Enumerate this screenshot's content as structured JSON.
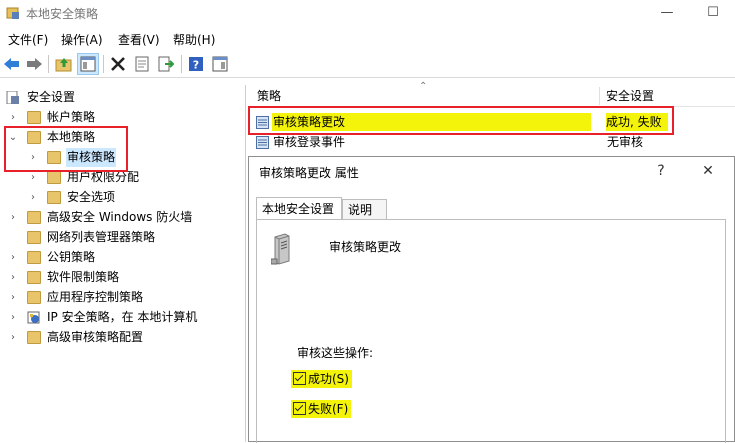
{
  "window": {
    "title": "本地安全策略",
    "minimize_glyph": "—",
    "maximize_glyph": "☐"
  },
  "menu": [
    "文件(F)",
    "操作(A)",
    "查看(V)",
    "帮助(H)"
  ],
  "toolbar": {
    "icons": [
      "back-icon",
      "forward-icon",
      "up-folder-icon",
      "show-tree-icon",
      "delete-icon",
      "properties-icon",
      "export-icon",
      "help-icon",
      "console-tree-icon"
    ]
  },
  "tree": {
    "root": "安全设置",
    "items": [
      {
        "label": "帐户策略"
      },
      {
        "label": "本地策略"
      },
      {
        "label": "审核策略"
      },
      {
        "label": "用户权限分配"
      },
      {
        "label": "安全选项"
      },
      {
        "label": "高级安全 Windows 防火墙"
      },
      {
        "label": "网络列表管理器策略"
      },
      {
        "label": "公钥策略"
      },
      {
        "label": "软件限制策略"
      },
      {
        "label": "应用程序控制策略"
      },
      {
        "label": "IP 安全策略，在 本地计算机"
      },
      {
        "label": "高级审核策略配置"
      }
    ]
  },
  "list": {
    "columns": [
      "策略",
      "安全设置"
    ],
    "rows": [
      {
        "policy": "审核策略更改",
        "setting": "成功, 失败"
      },
      {
        "policy": "审核登录事件",
        "setting": "无审核"
      }
    ]
  },
  "dialog": {
    "title": "审核策略更改 属性",
    "help_glyph": "?",
    "close_glyph": "✕",
    "tabs": [
      "本地安全设置",
      "说明"
    ],
    "policy_name": "审核策略更改",
    "audit_label": "审核这些操作:",
    "checkboxes": [
      {
        "label": "成功(S)",
        "checked": true
      },
      {
        "label": "失败(F)",
        "checked": true
      }
    ]
  },
  "colors": {
    "highlight": "#f4f40a",
    "annotation_red": "#e8202a",
    "selected_node": "#cce8ff"
  }
}
